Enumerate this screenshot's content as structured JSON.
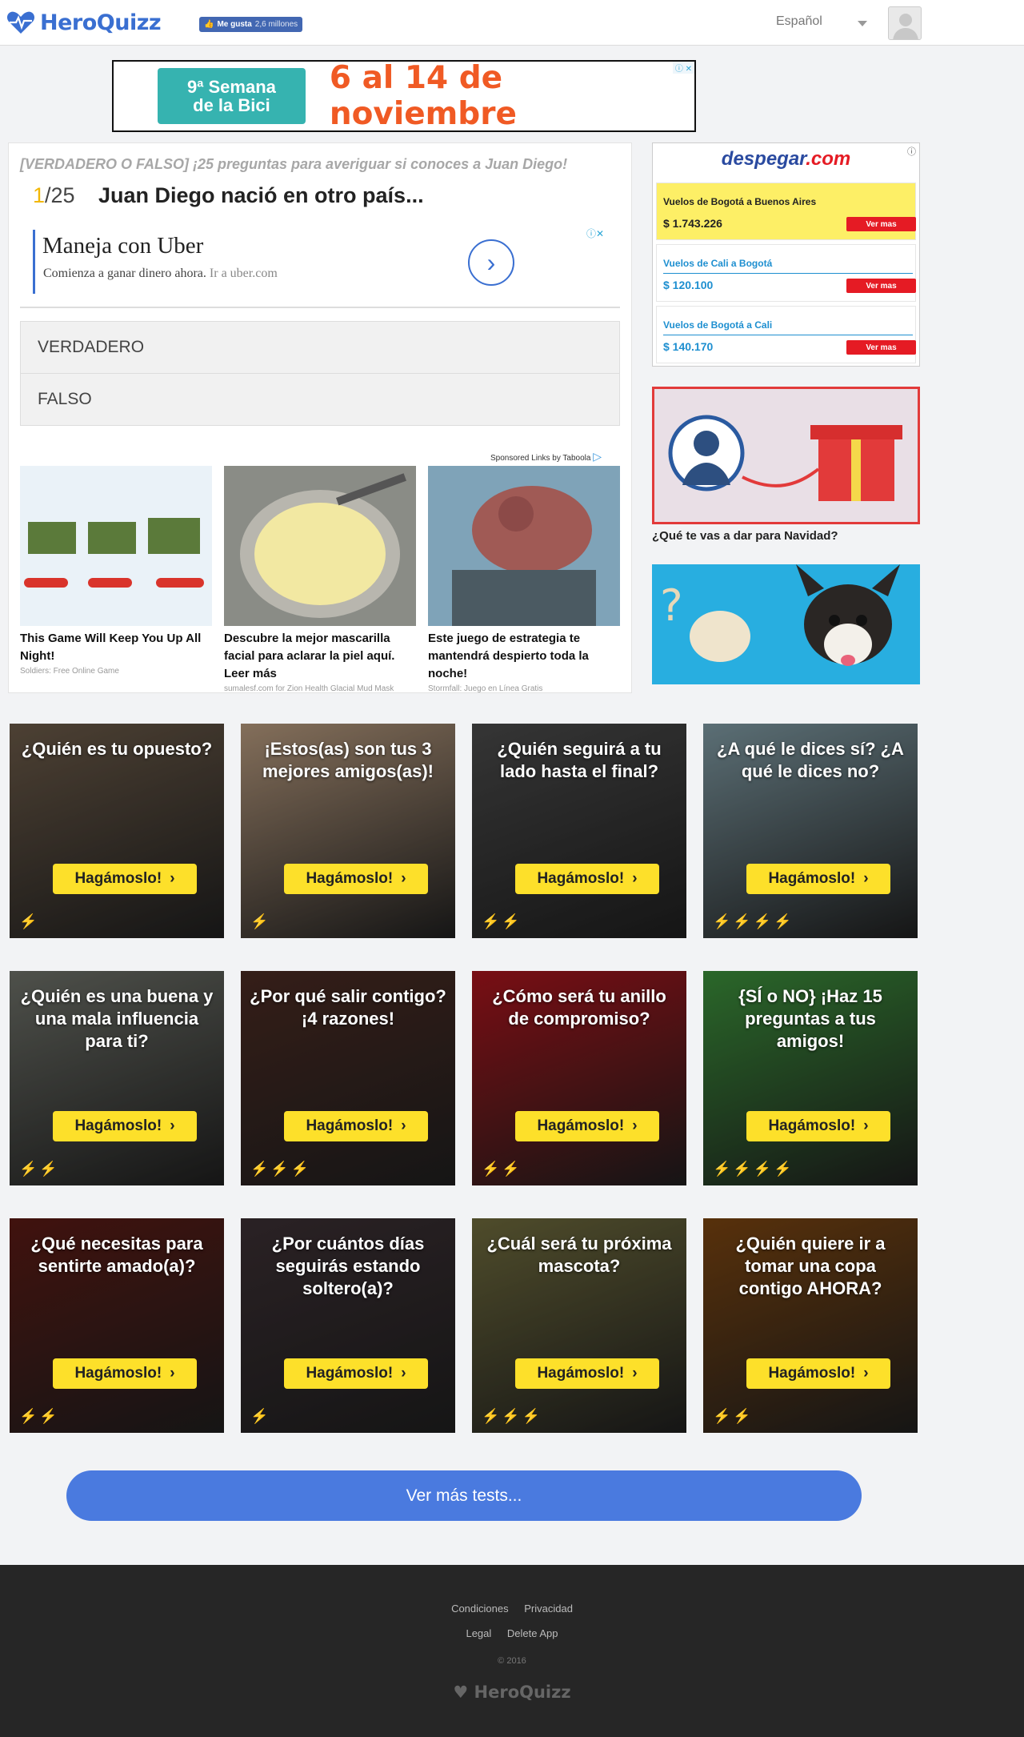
{
  "header": {
    "logo_text": "HeroQuizz",
    "fb_like_label": "Me gusta",
    "fb_like_count": "2,6 millones",
    "language": "Español"
  },
  "banner": {
    "badge_line1": "9ª Semana",
    "badge_line2": "de la Bici",
    "date_text": "6 al 14 de noviembre"
  },
  "quiz": {
    "heading": "[VERDADERO O FALSO] ¡25 preguntas para averiguar si conoces a Juan Diego!",
    "question_current": "1",
    "question_total": "/25",
    "question_text": "Juan Diego nació en otro país...",
    "answers": [
      "VERDADERO",
      "FALSO"
    ]
  },
  "uber_ad": {
    "title": "Maneja con Uber",
    "subtitle": "Comienza a ganar dinero ahora.",
    "link_text": "Ir a uber.com"
  },
  "taboola": {
    "label": "Sponsored Links by Taboola",
    "items": [
      {
        "title": "This Game Will Keep You Up All Night!",
        "source": "Soldiers: Free Online Game"
      },
      {
        "title": "Descubre la mejor mascarilla facial para aclarar la piel aquí. Leer más",
        "source": "sumalesf.com for Zion Health Glacial Mud Mask"
      },
      {
        "title": "Este juego de estrategia te mantendrá despierto toda la noche!",
        "source": "Stormfall: Juego en Línea Gratis"
      }
    ]
  },
  "despegar": {
    "brand_main": "despegar",
    "brand_dot": ".com",
    "items": [
      {
        "route": "Vuelos de Bogotá a Buenos Aires",
        "price": "$ 1.743.226",
        "cta": "Ver mas"
      },
      {
        "route": "Vuelos de Cali a Bogotá",
        "price": "$ 120.100",
        "cta": "Ver mas"
      },
      {
        "route": "Vuelos de Bogotá a Cali",
        "price": "$ 140.170",
        "cta": "Ver mas"
      }
    ]
  },
  "sidebar": {
    "xmas_caption": "¿Qué te vas a dar para Navidad?"
  },
  "tiles": [
    {
      "title": "¿Quién es tu opuesto?",
      "cta": "Hagámoslo!",
      "bolts": "⚡",
      "bolt_color": "#3a6fd1",
      "bg": "#6b5a48"
    },
    {
      "title": "¡Estos(as) son tus 3 mejores amigos(as)!",
      "cta": "Hagámoslo!",
      "bolts": "⚡",
      "bolt_color": "#3a6fd1",
      "bg": "#b79a7e"
    },
    {
      "title": "¿Quién seguirá a tu lado hasta el final?",
      "cta": "Hagámoslo!",
      "bolts": "⚡⚡",
      "bolt_color": "#3a6fd1",
      "bg": "#4a4a4a"
    },
    {
      "title": "¿A qué le dices sí? ¿A qué le dices no?",
      "cta": "Hagámoslo!",
      "bolts": "⚡⚡⚡⚡",
      "bolt_color": "#f2c01e",
      "bg": "#7f9aa3"
    },
    {
      "title": "¿Quién es una buena y una mala influencia para ti?",
      "cta": "Hagámoslo!",
      "bolts": "⚡⚡",
      "bolt_color": "#3a6fd1",
      "bg": "#6d7068"
    },
    {
      "title": "¿Por qué salir contigo? ¡4 razones!",
      "cta": "Hagámoslo!",
      "bolts": "⚡⚡⚡",
      "bolt_color": "#f2c01e",
      "bg": "#4a2a22"
    },
    {
      "title": "¿Cómo será tu anillo de compromiso?",
      "cta": "Hagámoslo!",
      "bolts": "⚡⚡",
      "bolt_color": "#3a6fd1",
      "bg": "#a8141c"
    },
    {
      "title": "{SÍ o NO} ¡Haz 15 preguntas a tus amigos!",
      "cta": "Hagámoslo!",
      "bolts": "⚡⚡⚡⚡",
      "bolt_color": "#f2c01e",
      "bg": "#3b8f3a"
    },
    {
      "title": "¿Qué necesitas para sentirte amado(a)?",
      "cta": "Hagámoslo!",
      "bolts": "⚡⚡",
      "bolt_color": "#3a6fd1",
      "bg": "#5a1a14"
    },
    {
      "title": "¿Por cuántos días seguirás estando soltero(a)?",
      "cta": "Hagámoslo!",
      "bolts": "⚡",
      "bolt_color": "#3a6fd1",
      "bg": "#3b2f33"
    },
    {
      "title": "¿Cuál será tu próxima mascota?",
      "cta": "Hagámoslo!",
      "bolts": "⚡⚡⚡",
      "bolt_color": "#f2c01e",
      "bg": "#6e6a3c"
    },
    {
      "title": "¿Quién quiere ir a tomar una copa contigo AHORA?",
      "cta": "Hagámoslo!",
      "bolts": "⚡⚡",
      "bolt_color": "#3a6fd1",
      "bg": "#7a4410"
    }
  ],
  "more_button": "Ver más tests...",
  "footer": {
    "links_row1": [
      "Condiciones",
      "Privacidad"
    ],
    "links_row2": [
      "Legal",
      "Delete App"
    ],
    "copyright": "© 2016",
    "logo_text": "HeroQuizz"
  }
}
